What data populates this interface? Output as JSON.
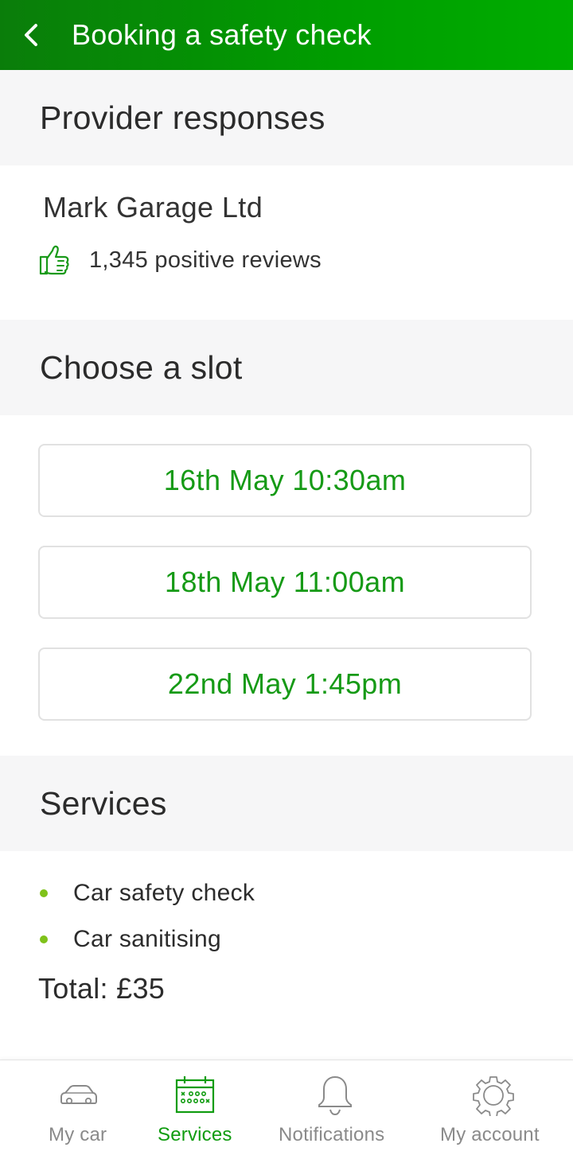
{
  "header": {
    "title": "Booking a safety check",
    "back_icon": "chevron-left-icon"
  },
  "sections": {
    "provider": "Provider responses",
    "slots": "Choose a slot",
    "services": "Services"
  },
  "provider": {
    "name": "Mark Garage Ltd",
    "reviews_icon": "thumbs-up-icon",
    "reviews": "1,345 positive reviews"
  },
  "slots": [
    {
      "label": "16th May 10:30am"
    },
    {
      "label": "18th May 11:00am"
    },
    {
      "label": "22nd May 1:45pm"
    }
  ],
  "services": {
    "items": [
      "Car safety check",
      "Car sanitising"
    ],
    "total": "Total: £35"
  },
  "tabs": [
    {
      "label": "My car",
      "icon": "car-icon",
      "active": false
    },
    {
      "label": "Services",
      "icon": "calendar-icon",
      "active": true
    },
    {
      "label": "Notifications",
      "icon": "bell-icon",
      "active": false
    },
    {
      "label": "My account",
      "icon": "gear-icon",
      "active": false
    }
  ],
  "colors": {
    "header_start": "#0a7d0a",
    "header_end": "#00ad00",
    "accent_green": "#169a16",
    "bullet_green": "#7fc21a",
    "section_bg": "#f6f6f7",
    "tab_inactive": "#8a8a8a"
  }
}
